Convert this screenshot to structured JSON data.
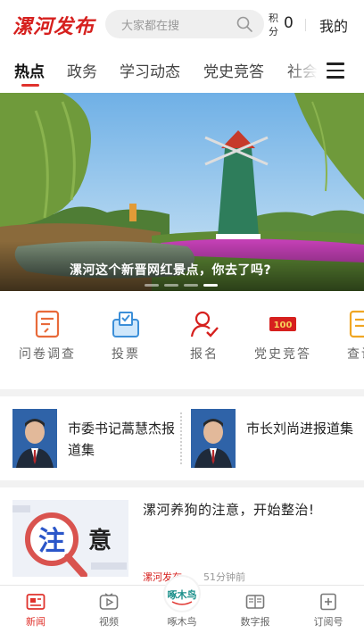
{
  "header": {
    "logo": "漯河发布",
    "search_placeholder": "大家都在搜",
    "points_label": "积分",
    "points_value": "0",
    "mine_label": "我的"
  },
  "tabs": [
    {
      "label": "热点",
      "active": true
    },
    {
      "label": "政务"
    },
    {
      "label": "学习动态"
    },
    {
      "label": "党史竞答"
    },
    {
      "label": "社会"
    }
  ],
  "banner": {
    "title": "漯河这个新晋网红景点，你去了吗?",
    "slide_count": 4,
    "active_slide": 4
  },
  "quick_links": [
    {
      "label": "问卷调查",
      "icon": "survey-icon"
    },
    {
      "label": "投票",
      "icon": "vote-icon"
    },
    {
      "label": "报名",
      "icon": "signup-icon"
    },
    {
      "label": "党史竞答",
      "icon": "party-history-icon"
    },
    {
      "label": "查询",
      "icon": "query-icon"
    }
  ],
  "leaders": [
    {
      "label": "市委书记蒿慧杰报道集"
    },
    {
      "label": "市长刘尚进报道集"
    }
  ],
  "news": [
    {
      "title": "漯河养狗的注意，开始整治!",
      "source": "漯河发布",
      "time": "51分钟前",
      "thumb_text_1": "注",
      "thumb_text_2": "意"
    }
  ],
  "bottom_nav": [
    {
      "label": "新闻",
      "icon": "news-icon",
      "active": true
    },
    {
      "label": "视频",
      "icon": "video-icon"
    },
    {
      "label": "啄木鸟",
      "icon": "woodpecker-icon",
      "badge_text": "啄木鸟"
    },
    {
      "label": "数字报",
      "icon": "digital-paper-icon"
    },
    {
      "label": "订阅号",
      "icon": "subscription-icon"
    }
  ],
  "colors": {
    "brand": "#d6201e",
    "accent": "#e0322c"
  }
}
